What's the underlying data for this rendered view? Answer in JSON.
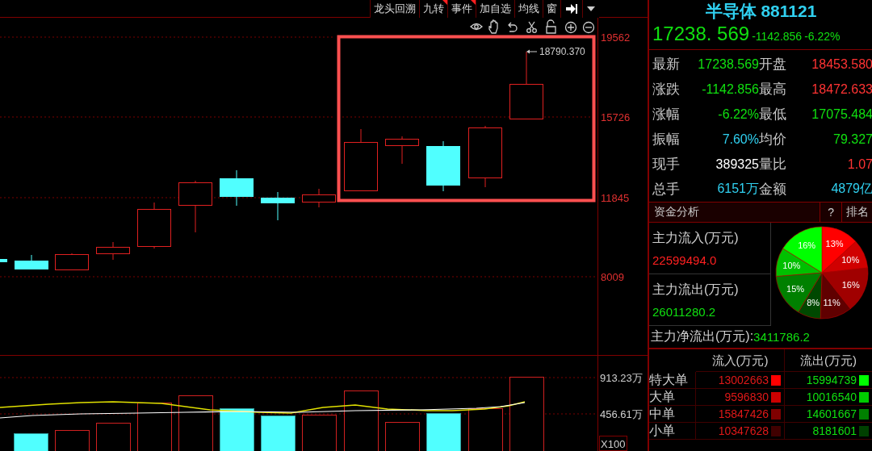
{
  "toolbar": {
    "buttons": [
      {
        "label": "龙头回溯",
        "flagged": false
      },
      {
        "label": "九转",
        "flagged": true
      },
      {
        "label": "事件",
        "flagged": true
      },
      {
        "label": "加自选",
        "flagged": false
      },
      {
        "label": "均线",
        "flagged": false
      },
      {
        "label": "窗",
        "flagged": false
      }
    ]
  },
  "price_chart": {
    "y_ticks": [
      "19562",
      "15726",
      "11845",
      "8009"
    ],
    "high_marker": "18790.370"
  },
  "volume_chart": {
    "y_ticks": [
      "913.23万",
      "456.61万"
    ],
    "scale": "X100"
  },
  "quote": {
    "name": "半导体 881121",
    "price": "17238. 569",
    "change": "-1142.856",
    "change_pct": "-6.22%"
  },
  "stats": [
    {
      "label": "最新",
      "value": "17238.569",
      "color": "#10e010"
    },
    {
      "label": "开盘",
      "value": "18453.580",
      "color": "#ff3333"
    },
    {
      "label": "涨跌",
      "value": "-1142.856",
      "color": "#10e010"
    },
    {
      "label": "最高",
      "value": "18472.633",
      "color": "#ff3333"
    },
    {
      "label": "涨幅",
      "value": "-6.22%",
      "color": "#10e010"
    },
    {
      "label": "最低",
      "value": "17075.484",
      "color": "#10e010"
    },
    {
      "label": "振幅",
      "value": "7.60%",
      "color": "#30d0f0"
    },
    {
      "label": "均价",
      "value": "79.327",
      "color": "#10e010"
    },
    {
      "label": "现手",
      "value": "389325",
      "color": "#ffffff"
    },
    {
      "label": "量比",
      "value": "1.07",
      "color": "#ff3333"
    },
    {
      "label": "总手",
      "value": "6151万",
      "color": "#30d0f0"
    },
    {
      "label": "金额",
      "value": "4879亿",
      "color": "#30d0f0"
    }
  ],
  "fund_analysis": {
    "title": "资金分析",
    "help": "?",
    "rank": "排名",
    "inflow_label": "主力流入(万元)",
    "inflow": "22599494.0",
    "outflow_label": "主力流出(万元)",
    "outflow": "26011280.2",
    "net_label": "主力净流出(万元):",
    "net": "3411786.2",
    "chart_data": {
      "type": "pie",
      "values": [
        13,
        10,
        16,
        11,
        8,
        15,
        10,
        16
      ],
      "colors": [
        "#ff0000",
        "#d00000",
        "#a00000",
        "#600000",
        "#004800",
        "#008000",
        "#00c000",
        "#00ff00"
      ],
      "value_labels": [
        "13%",
        "10%",
        "16%",
        "11%",
        "8%",
        "15%",
        "10%",
        "16%"
      ]
    }
  },
  "orders": {
    "columns": [
      "流入(万元)",
      "流出(万元)"
    ],
    "rows": [
      {
        "label": "特大单",
        "inflow": {
          "value": "13002663",
          "color": "#ff0000"
        },
        "outflow": {
          "value": "15994739",
          "color": "#00ff00"
        }
      },
      {
        "label": "大单",
        "inflow": {
          "value": "9596830",
          "color": "#cc0000"
        },
        "outflow": {
          "value": "10016540",
          "color": "#00cc00"
        }
      },
      {
        "label": "中单",
        "inflow": {
          "value": "15847426",
          "color": "#800000"
        },
        "outflow": {
          "value": "14601667",
          "color": "#008000"
        }
      },
      {
        "label": "小单",
        "inflow": {
          "value": "10347628",
          "color": "#400000"
        },
        "outflow": {
          "value": "8181601",
          "color": "#004000"
        }
      }
    ]
  }
}
